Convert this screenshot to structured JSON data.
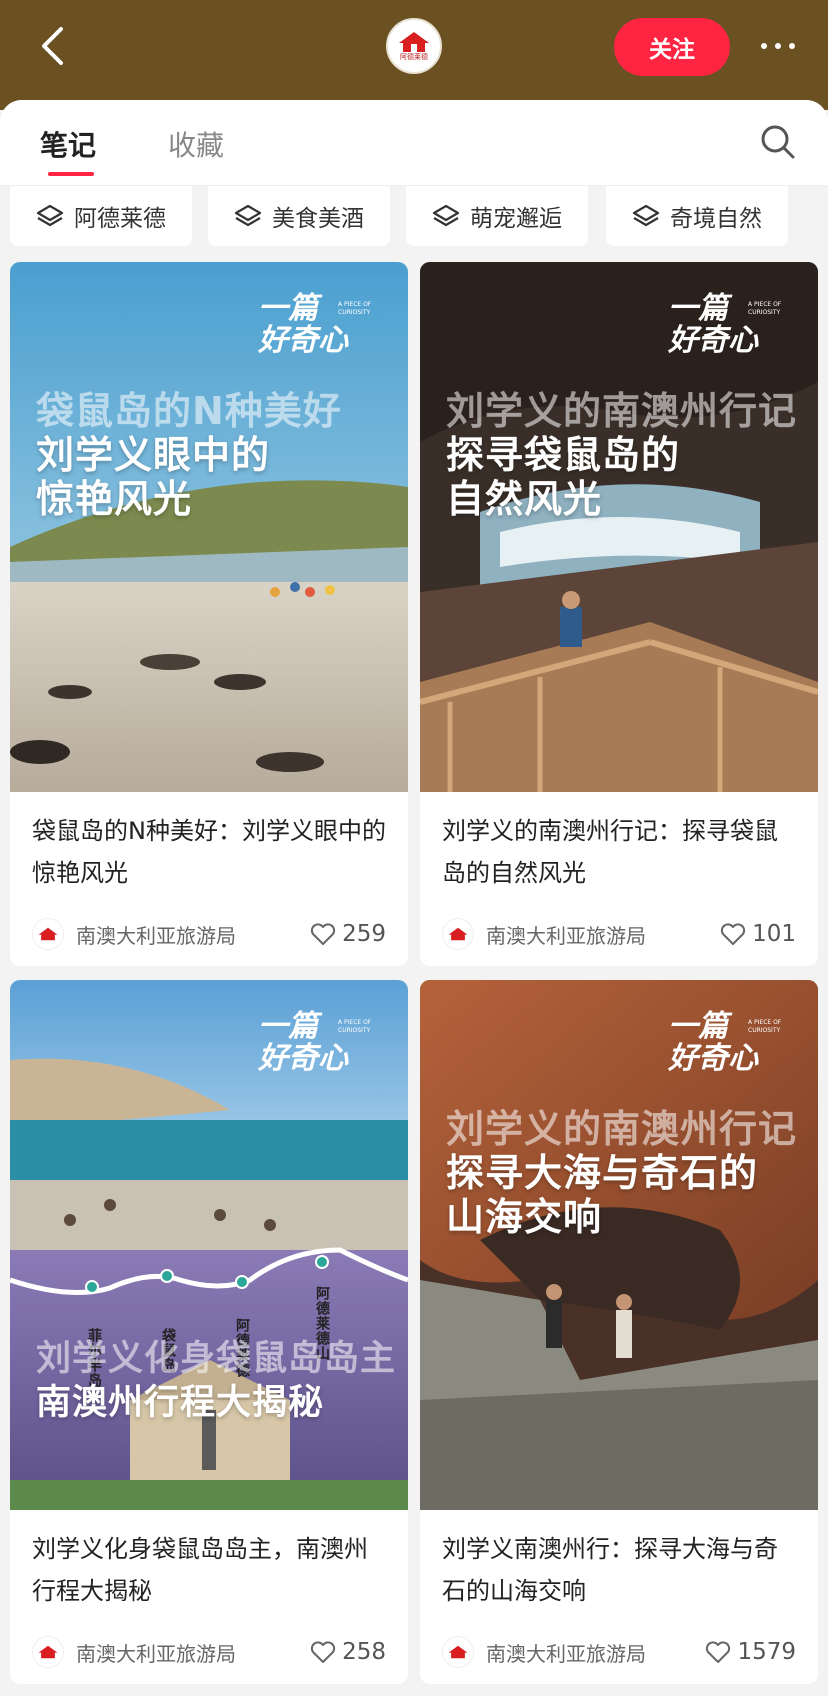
{
  "header": {
    "back_icon": "chevron-left-icon",
    "logo_text": "阿德莱德",
    "follow_label": "关注",
    "more_icon": "more-dots-icon"
  },
  "tabs": {
    "notes_label": "笔记",
    "favorites_label": "收藏",
    "search_icon": "search-icon"
  },
  "chips": [
    {
      "label": "阿德莱德",
      "icon": "layers-icon"
    },
    {
      "label": "美食美酒",
      "icon": "layers-icon"
    },
    {
      "label": "萌宠邂逅",
      "icon": "layers-icon"
    },
    {
      "label": "奇境自然",
      "icon": "layers-icon"
    }
  ],
  "brand_mark": {
    "main": "一篇好奇心",
    "sub": "A PIECE OF CURIOSITY"
  },
  "cards": [
    {
      "overlay": [
        "袋鼠岛的N种美好",
        "刘学义眼中的",
        "惊艳风光"
      ],
      "title": "袋鼠岛的N种美好：刘学义眼中的惊艳风光",
      "author": "南澳大利亚旅游局",
      "likes": "259"
    },
    {
      "overlay": [
        "刘学义的南澳州行记",
        "探寻袋鼠岛的",
        "自然风光"
      ],
      "title": "刘学义的南澳州行记：探寻袋鼠岛的自然风光",
      "author": "南澳大利亚旅游局",
      "likes": "101"
    },
    {
      "overlay": [
        "刘学义化身袋鼠岛岛主",
        "南澳州行程大揭秘"
      ],
      "route": [
        "菲尔半岛",
        "袋鼠岛",
        "阿德莱德",
        "阿德莱德山"
      ],
      "title": "刘学义化身袋鼠岛岛主，南澳州行程大揭秘",
      "author": "南澳大利亚旅游局",
      "likes": "258"
    },
    {
      "overlay": [
        "刘学义的南澳州行记",
        "探寻大海与奇石的",
        "山海交响"
      ],
      "title": "刘学义南澳州行：探寻大海与奇石的山海交响",
      "author": "南澳大利亚旅游局",
      "likes": "1579"
    }
  ],
  "colors": {
    "accent": "#ff2442",
    "header_bg": "#6b5121"
  }
}
